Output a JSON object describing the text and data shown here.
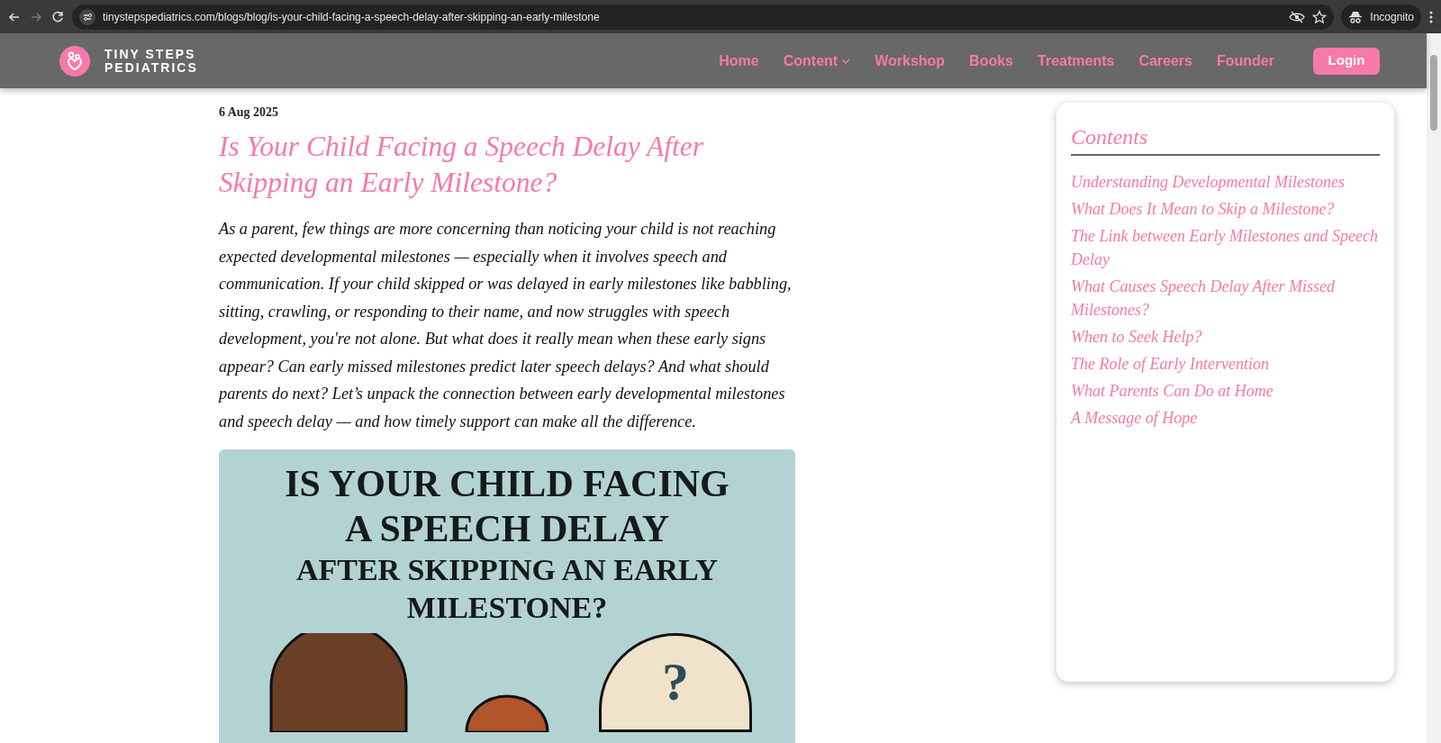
{
  "browser": {
    "url": "tinystepspediatrics.com/blogs/blog/is-your-child-facing-a-speech-delay-after-skipping-an-early-milestone",
    "profile": "Incognito"
  },
  "navbar": {
    "brand_lines": [
      "TINY STEPS",
      "PEDIATRICS"
    ],
    "links": [
      {
        "label": "Home",
        "dropdown": false
      },
      {
        "label": "Content",
        "dropdown": true
      },
      {
        "label": "Workshop",
        "dropdown": false
      },
      {
        "label": "Books",
        "dropdown": false
      },
      {
        "label": "Treatments",
        "dropdown": false
      },
      {
        "label": "Careers",
        "dropdown": false
      },
      {
        "label": "Founder",
        "dropdown": false
      }
    ],
    "login": "Login"
  },
  "article": {
    "date": "6 Aug 2025",
    "title": "Is Your Child Facing a Speech Delay After Skipping an Early Milestone?",
    "intro": "As a parent, few things are more concerning than noticing your child is not reaching expected developmental milestones — especially when it involves speech and communication. If your child skipped or was delayed in early milestones like babbling, sitting, crawling, or responding to their name, and now struggles with speech development, you're not alone. But what does it really mean when these early signs appear? Can early missed milestones predict later speech delays? And what should parents do next? Let’s unpack the connection between early developmental milestones and speech delay — and how timely support can make all the difference.",
    "illustration": {
      "title_lines": [
        "IS YOUR CHILD FACING",
        "A SPEECH DELAY",
        "AFTER SKIPPING AN EARLY",
        "MILESTONE?"
      ],
      "bubble_text": "?"
    }
  },
  "contents": {
    "heading": "Contents",
    "items": [
      "Understanding Developmental Milestones",
      "What Does It Mean to Skip a Milestone?",
      "The Link between Early Milestones and Speech Delay",
      "What Causes Speech Delay After Missed Milestones?",
      "When to Seek Help?",
      "The Role of Early Intervention",
      "What Parents Can Do at Home",
      "A Message of Hope"
    ]
  }
}
